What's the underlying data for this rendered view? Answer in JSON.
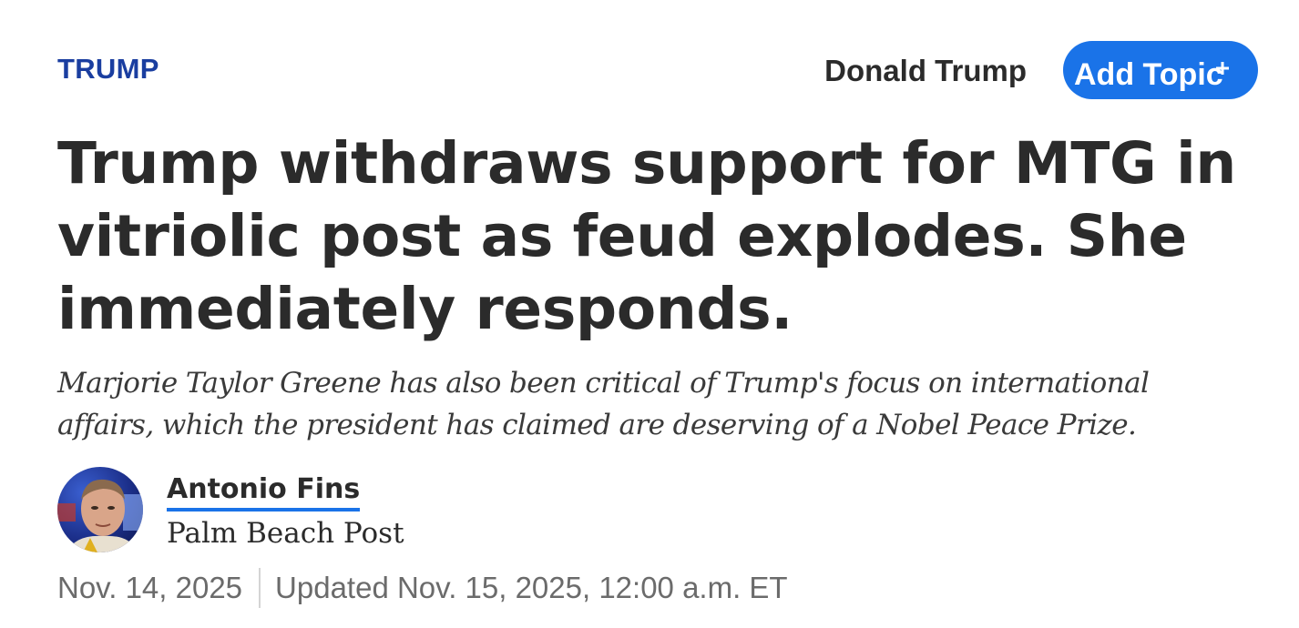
{
  "header": {
    "section_label": "TRUMP",
    "topic_name": "Donald Trump",
    "add_topic_label": "Add Topic"
  },
  "article": {
    "headline": "Trump withdraws support for MTG in vitriolic post as feud explodes. She immediately responds.",
    "dek": "Marjorie Taylor Greene has also been critical of Trump's focus on international affairs, which the president has claimed are deserving of a Nobel Peace Prize."
  },
  "byline": {
    "author": "Antonio Fins",
    "publication": "Palm Beach Post"
  },
  "dateline": {
    "published": "Nov. 14, 2025",
    "updated": "Updated Nov. 15, 2025, 12:00 a.m. ET"
  },
  "colors": {
    "section_label": "#1a3ea0",
    "accent_blue": "#1a73e8",
    "text_primary": "#2b2b2b",
    "text_muted": "#6b6b6b"
  },
  "icons": {
    "add_topic": "plus-icon",
    "author": "avatar"
  }
}
